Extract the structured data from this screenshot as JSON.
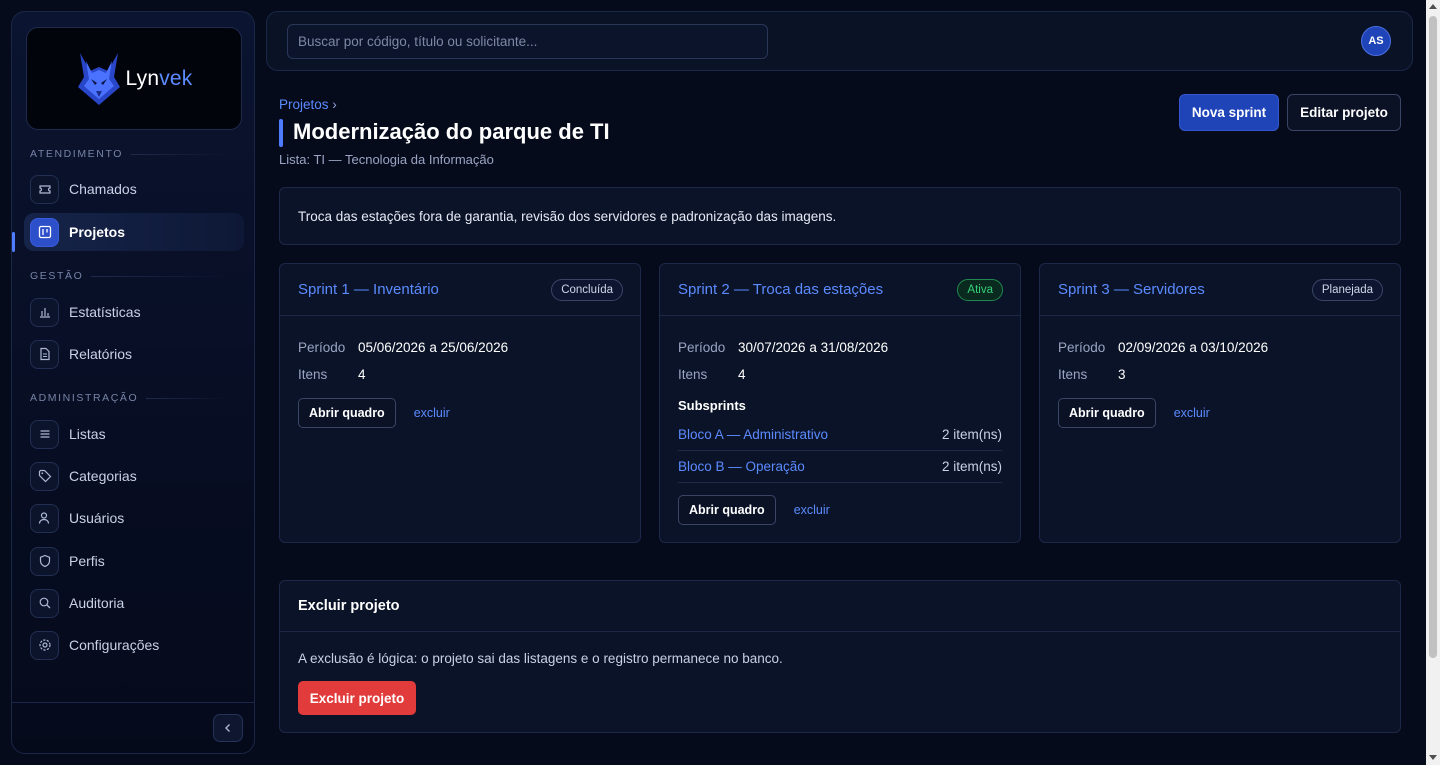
{
  "brand": {
    "name_prefix": "Lyn",
    "name_suffix": "vek",
    "accent": "#5b8bff"
  },
  "topbar": {
    "search_placeholder": "Buscar por código, título ou solicitante...",
    "avatar_initials": "AS"
  },
  "sidebar": {
    "sections": [
      {
        "label": "ATENDIMENTO"
      },
      {
        "label": "GESTÃO"
      },
      {
        "label": "ADMINISTRAÇÃO"
      }
    ],
    "items": [
      {
        "label": "Chamados",
        "icon": "ticket-icon"
      },
      {
        "label": "Projetos",
        "icon": "kanban-icon",
        "active": true
      },
      {
        "label": "Estatísticas",
        "icon": "bar-chart-icon"
      },
      {
        "label": "Relatórios",
        "icon": "document-icon"
      },
      {
        "label": "Listas",
        "icon": "list-icon"
      },
      {
        "label": "Categorias",
        "icon": "tag-icon"
      },
      {
        "label": "Usuários",
        "icon": "user-icon"
      },
      {
        "label": "Perfis",
        "icon": "shield-icon"
      },
      {
        "label": "Auditoria",
        "icon": "search-icon"
      },
      {
        "label": "Configurações",
        "icon": "gear-icon"
      }
    ]
  },
  "header": {
    "breadcrumb": "Projetos",
    "breadcrumb_sep": "›",
    "title": "Modernização do parque de TI",
    "subtitle": "Lista: TI — Tecnologia da Informação",
    "new_sprint_label": "Nova sprint",
    "edit_project_label": "Editar projeto"
  },
  "description": "Troca das estações fora de garantia, revisão dos servidores e padronização das imagens.",
  "labels": {
    "period": "Período",
    "items": "Itens",
    "open_board": "Abrir quadro",
    "delete": "excluir",
    "subsprints": "Subsprints"
  },
  "sprints": [
    {
      "title": "Sprint 1 — Inventário",
      "status": "Concluída",
      "period": "05/06/2026 a 25/06/2026",
      "items": "4"
    },
    {
      "title": "Sprint 2 — Troca das estações",
      "status": "Ativa",
      "period": "30/07/2026 a 31/08/2026",
      "items": "4",
      "subsprints": [
        {
          "name": "Bloco A — Administrativo",
          "count": "2 item(ns)"
        },
        {
          "name": "Bloco B — Operação",
          "count": "2 item(ns)"
        }
      ]
    },
    {
      "title": "Sprint 3 — Servidores",
      "status": "Planejada",
      "period": "02/09/2026 a 03/10/2026",
      "items": "3"
    }
  ],
  "danger": {
    "title": "Excluir projeto",
    "text": "A exclusão é lógica: o projeto sai das listagens e o registro permanece no banco.",
    "button_label": "Excluir projeto",
    "color": "#e23b3b"
  },
  "colors": {
    "background": "#060b1c",
    "card": "#0b1328",
    "primary": "#1e44b8",
    "success": "#35d07a"
  }
}
